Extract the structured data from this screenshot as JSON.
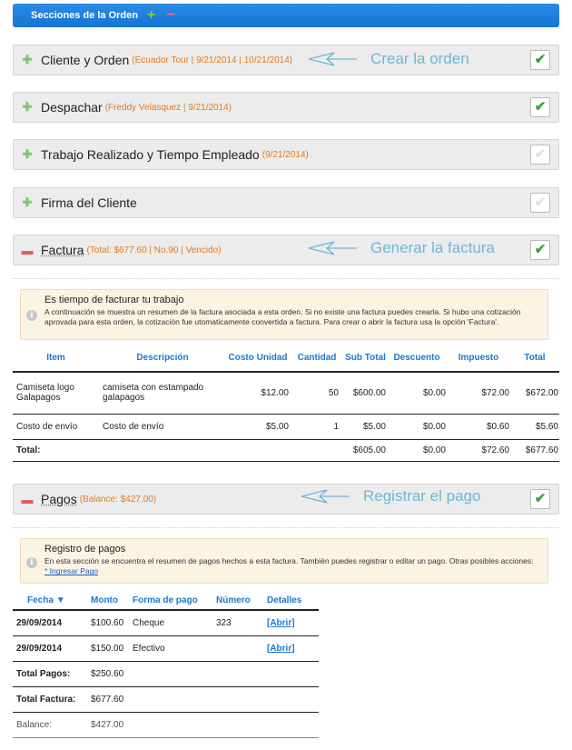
{
  "header": {
    "title": "Secciones de la Orden",
    "add_icon": "plus-icon",
    "remove_icon": "minus-icon",
    "bar_color": "#1f82e0"
  },
  "sections": {
    "cliente": {
      "title": "Cliente y Orden",
      "meta": "(Ecuador Tour | 9/21/2014 | 10/21/2014)",
      "checked": true
    },
    "despachar": {
      "title": "Despachar",
      "meta": "(Freddy Velasquez | 9/21/2014)",
      "checked": true
    },
    "trabajo": {
      "title": "Trabajo Realizado y Tiempo Empleado",
      "meta": "(9/21/2014)",
      "checked": false
    },
    "firma": {
      "title": "Firma del Cliente",
      "meta": "",
      "checked": false
    },
    "factura": {
      "title": "Factura",
      "meta": "(Total: $677.60 | No.90 | Vencido)",
      "checked": true
    },
    "pagos": {
      "title": "Pagos",
      "meta": "(Balance: $427.00)",
      "checked": true
    }
  },
  "annotations": {
    "crear": "Crear la orden",
    "generar": "Generar la factura",
    "registrar": "Registrar el pago"
  },
  "invoice_notice": {
    "title": "Es tiempo de facturar tu trabajo",
    "body": "A continuación se muestra un resumen de la factura asociada a esta orden. Si no existe una factura puedes crearla. Si hubo una cotización aprovada para esta orden, la cotización fue utomaticamente convertida a factura. Para crear o abrir la factura usa la opción 'Factura'."
  },
  "invoice": {
    "headers": [
      "Item",
      "Descripción",
      "Costo Unidad",
      "Cantidad",
      "Sub Total",
      "Descuento",
      "Impuesto",
      "Total"
    ],
    "rows": [
      {
        "item": "Camiseta logo Galapagos",
        "desc": "camiseta con estampado galapagos",
        "cost": "$12.00",
        "qty": "50",
        "sub": "$600.00",
        "disc": "$0.00",
        "tax": "$72.00",
        "total": "$672.00"
      },
      {
        "item": "Costo de envío",
        "desc": "Costo de envío",
        "cost": "$5.00",
        "qty": "1",
        "sub": "$5.00",
        "disc": "$0.00",
        "tax": "$0.60",
        "total": "$5.60"
      }
    ],
    "totals": {
      "label": "Total:",
      "sub": "$605.00",
      "disc": "$0.00",
      "tax": "$72.60",
      "total": "$677.60"
    }
  },
  "payments_notice": {
    "title": "Registro de pagos",
    "body": "En esta sección se encuentra el resumen de pagos hechos a esta factura. También puedes registrar o editar un pago. Otras posibles acciones:",
    "link": "* Ingresar Pago"
  },
  "payments": {
    "headers": {
      "fecha": "Fecha",
      "monto": "Monto",
      "forma": "Forma de pago",
      "numero": "Número",
      "detalles": "Detalles"
    },
    "rows": [
      {
        "fecha": "29/09/2014",
        "monto": "$100.60",
        "forma": "Cheque",
        "numero": "323",
        "detalles": "[Abrir]"
      },
      {
        "fecha": "29/09/2014",
        "monto": "$150.00",
        "forma": "Efectivo",
        "numero": "",
        "detalles": "[Abrir]"
      }
    ],
    "total_pagos": {
      "label": "Total Pagos:",
      "value": "$250.60"
    },
    "total_factura": {
      "label": "Total Factura:",
      "value": "$677.60"
    },
    "balance": {
      "label": "Balance:",
      "value": "$427.00"
    }
  }
}
